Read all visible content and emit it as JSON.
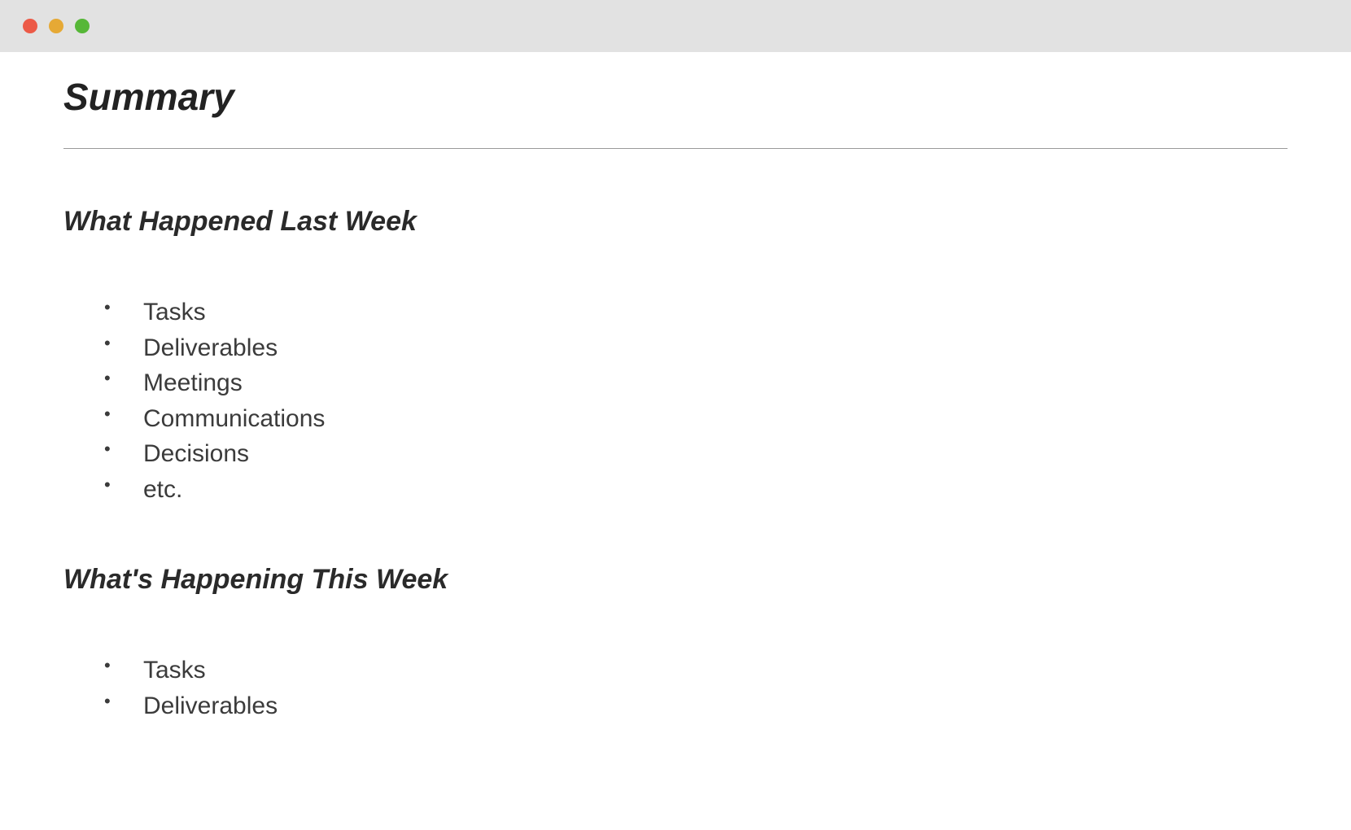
{
  "document": {
    "title": "Summary",
    "sections": [
      {
        "heading": "What Happened Last Week",
        "items": [
          "Tasks",
          "Deliverables",
          "Meetings",
          "Communications",
          "Decisions",
          "etc."
        ]
      },
      {
        "heading": "What's Happening This Week",
        "items": [
          "Tasks",
          "Deliverables"
        ]
      }
    ]
  }
}
